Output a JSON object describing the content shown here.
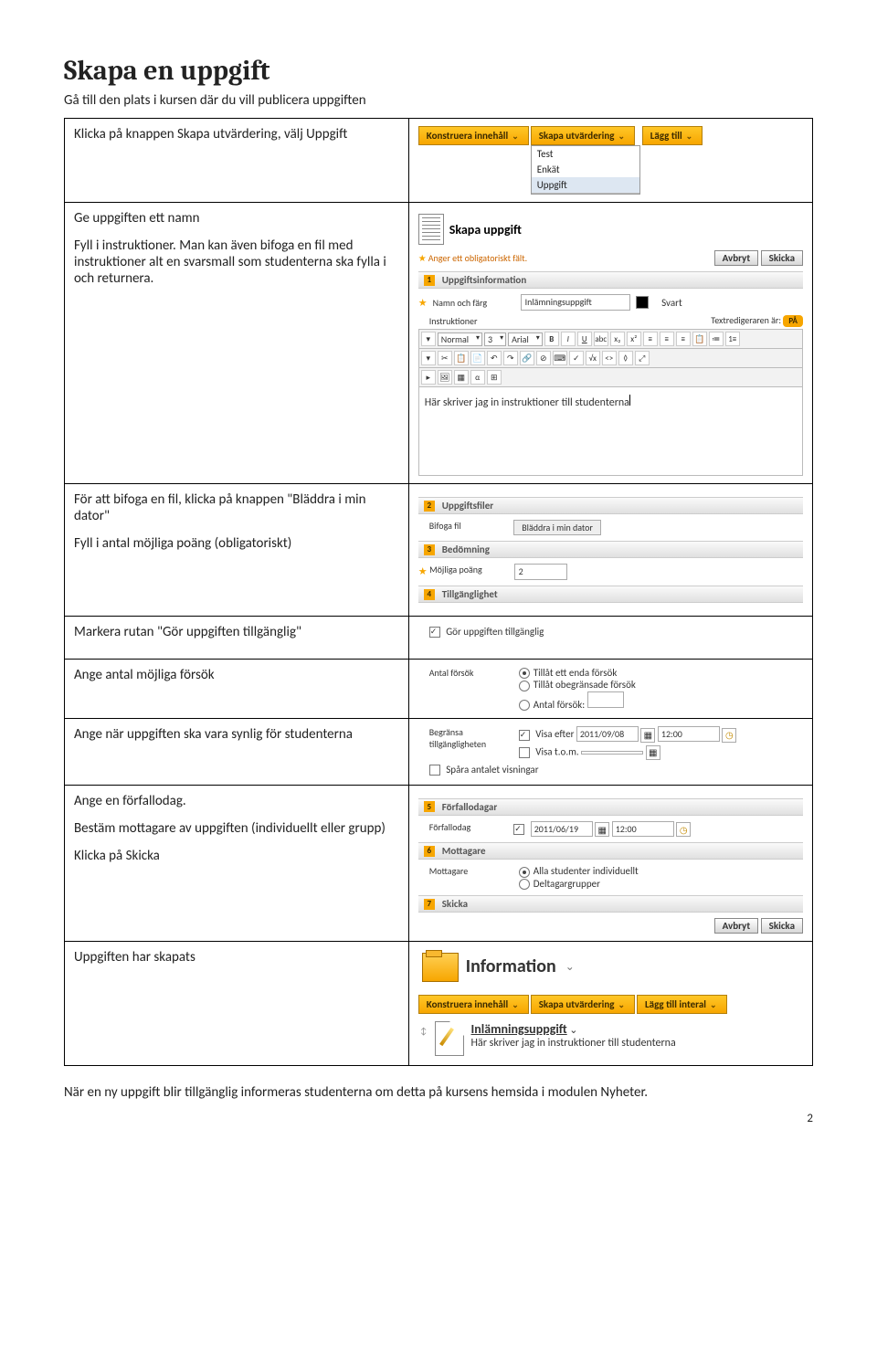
{
  "title": "Skapa en uppgift",
  "subtitle": "Gå till den plats i kursen där du vill publicera uppgiften",
  "row1": {
    "left": "Klicka på knappen Skapa utvärdering, välj Uppgift",
    "tabs": {
      "construct": "Konstruera innehåll",
      "create": "Skapa utvärdering",
      "add": "Lägg till"
    },
    "menu": {
      "test": "Test",
      "enkat": "Enkät",
      "uppgift": "Uppgift"
    }
  },
  "row2": {
    "left_p1": "Ge uppgiften ett namn",
    "left_p2": "Fyll i instruktioner. Man kan även bifoga en fil med instruktioner alt en svarsmall som studenterna ska fylla i och returnera.",
    "form_title": "Skapa uppgift",
    "mandatory_note": "Anger ett obligatoriskt fält.",
    "btn_cancel": "Avbryt",
    "btn_submit": "Skicka",
    "sec1": "Uppgiftsinformation",
    "name_label": "Namn och färg",
    "name_value": "Inlämningsuppgift",
    "color_label": "Svart",
    "instr_label": "Instruktioner",
    "editor_mode": "Textredigeraren är:",
    "editor_on": "PÅ",
    "tb": {
      "normal": "Normal",
      "size": "3",
      "face": "Arial"
    },
    "editor_text": "Här skriver jag in instruktioner till studenterna"
  },
  "row3": {
    "left_p1": "För att bifoga en fil, klicka på knappen \"Bläddra i min dator\"",
    "left_p2": "Fyll i antal möjliga poäng (obligatoriskt)",
    "sec2": "Uppgiftsfiler",
    "attach_label": "Bifoga fil",
    "browse": "Bläddra i min dator",
    "sec3": "Bedömning",
    "points_label": "Möjliga poäng",
    "points_value": "2",
    "sec4": "Tillgänglighet"
  },
  "row4": {
    "left": "Markera rutan \"Gör uppgiften tillgänglig\"",
    "avail": "Gör uppgiften tillgänglig"
  },
  "row5": {
    "left": "Ange antal möjliga försök",
    "tries_label": "Antal försök",
    "opt1": "Tillåt ett enda försök",
    "opt2": "Tillåt obegränsade försök",
    "opt3": "Antal försök:"
  },
  "row6": {
    "left": "Ange när uppgiften ska vara synlig för studenterna",
    "limit_label": "Begränsa tillgängligheten",
    "after": "Visa efter",
    "d1": "2011/09/08",
    "t1": "12:00",
    "until": "Visa t.o.m.",
    "track": "Spåra antalet visningar"
  },
  "row7": {
    "left_p1": "Ange en förfallodag.",
    "left_p2": "Bestäm mottagare av uppgiften (individuellt eller grupp)",
    "left_p3": "Klicka på Skicka",
    "sec5": "Förfallodagar",
    "due_label": "Förfallodag",
    "d2": "2011/06/19",
    "t2": "12:00",
    "sec6": "Mottagare",
    "rcpt_label": "Mottagare",
    "ropt1": "Alla studenter individuellt",
    "ropt2": "Deltagargrupper",
    "sec7": "Skicka"
  },
  "row8": {
    "left": "Uppgiften har skapats",
    "info": "Information",
    "tabs": {
      "construct": "Konstruera innehåll",
      "create": "Skapa utvärdering",
      "add": "Lägg till interal"
    },
    "item_title": "Inlämningsuppgift",
    "item_text": "Här skriver jag in instruktioner till studenterna"
  },
  "footer": "När en ny uppgift blir tillgänglig informeras studenterna om detta på kursens hemsida i modulen Nyheter.",
  "page_num": "2"
}
